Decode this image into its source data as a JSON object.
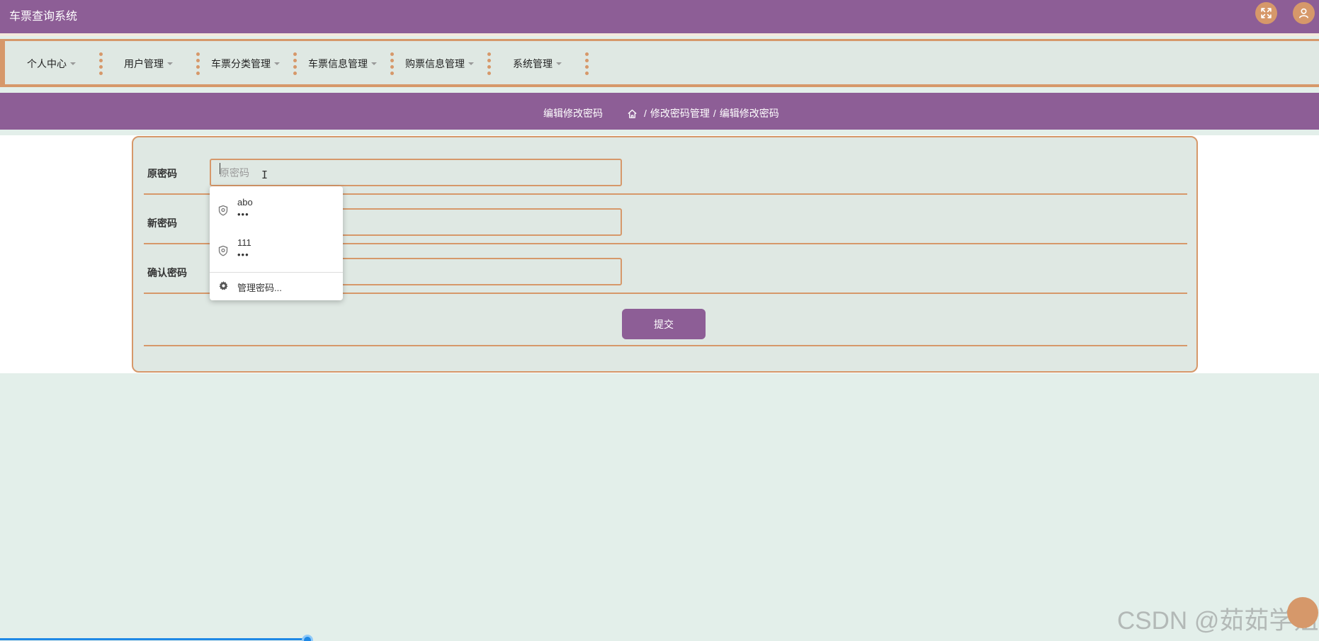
{
  "header": {
    "title": "车票查询系统",
    "accent_color": "#8d5e96",
    "secondary_color": "#d6986a",
    "fullscreen_icon": "expand-arrows-icon",
    "user_icon": "user-icon"
  },
  "nav": {
    "items": [
      {
        "label": "个人中心"
      },
      {
        "label": "用户管理"
      },
      {
        "label": "车票分类管理"
      },
      {
        "label": "车票信息管理"
      },
      {
        "label": "购票信息管理"
      },
      {
        "label": "系统管理"
      }
    ]
  },
  "breadcrumb": {
    "page_name": "编辑修改密码",
    "home_icon": "home-icon",
    "items": [
      "修改密码管理",
      "编辑修改密码"
    ],
    "separator": "/"
  },
  "form": {
    "fields": [
      {
        "label": "原密码",
        "placeholder": "原密码",
        "value": ""
      },
      {
        "label": "新密码",
        "placeholder": "",
        "value": ""
      },
      {
        "label": "确认密码",
        "placeholder": "",
        "value": ""
      }
    ],
    "submit_label": "提交"
  },
  "password_popup": {
    "entries": [
      {
        "username": "abo",
        "masked": "•••"
      },
      {
        "username": "111",
        "masked": "•••"
      }
    ],
    "manage_label": "管理密码..."
  },
  "progress": {
    "value_percent": 23.3
  },
  "watermark": "CSDN @茹茹学姐"
}
